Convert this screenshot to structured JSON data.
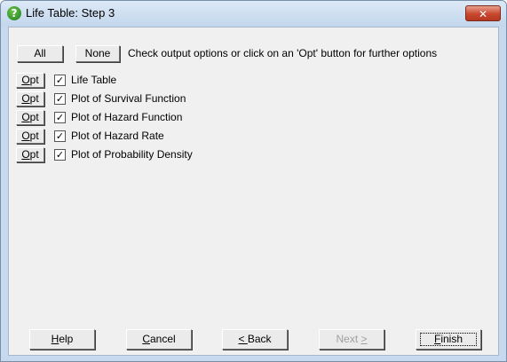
{
  "window": {
    "title": "Life Table: Step 3",
    "title_icon": "?",
    "close_glyph": "✕"
  },
  "top": {
    "all_label": "All",
    "none_label": "None",
    "hint": "Check output options or click on an 'Opt' button for further options"
  },
  "options": {
    "opt_label_first": "O",
    "opt_label_rest": "pt",
    "items": [
      {
        "label": "Life Table",
        "checked": true
      },
      {
        "label": "Plot of Survival Function",
        "checked": true
      },
      {
        "label": "Plot of Hazard Function",
        "checked": true
      },
      {
        "label": "Plot of Hazard Rate",
        "checked": true
      },
      {
        "label": "Plot of Probability Density",
        "checked": true
      }
    ],
    "check_glyph": "✓"
  },
  "footer": {
    "help": {
      "first": "H",
      "rest": "elp"
    },
    "cancel": {
      "first": "C",
      "rest": "ancel"
    },
    "back": {
      "first": "< ",
      "rest": "Back"
    },
    "next": {
      "first": "Next ",
      "rest": ">"
    },
    "finish": {
      "first": "F",
      "rest": "inish"
    }
  }
}
